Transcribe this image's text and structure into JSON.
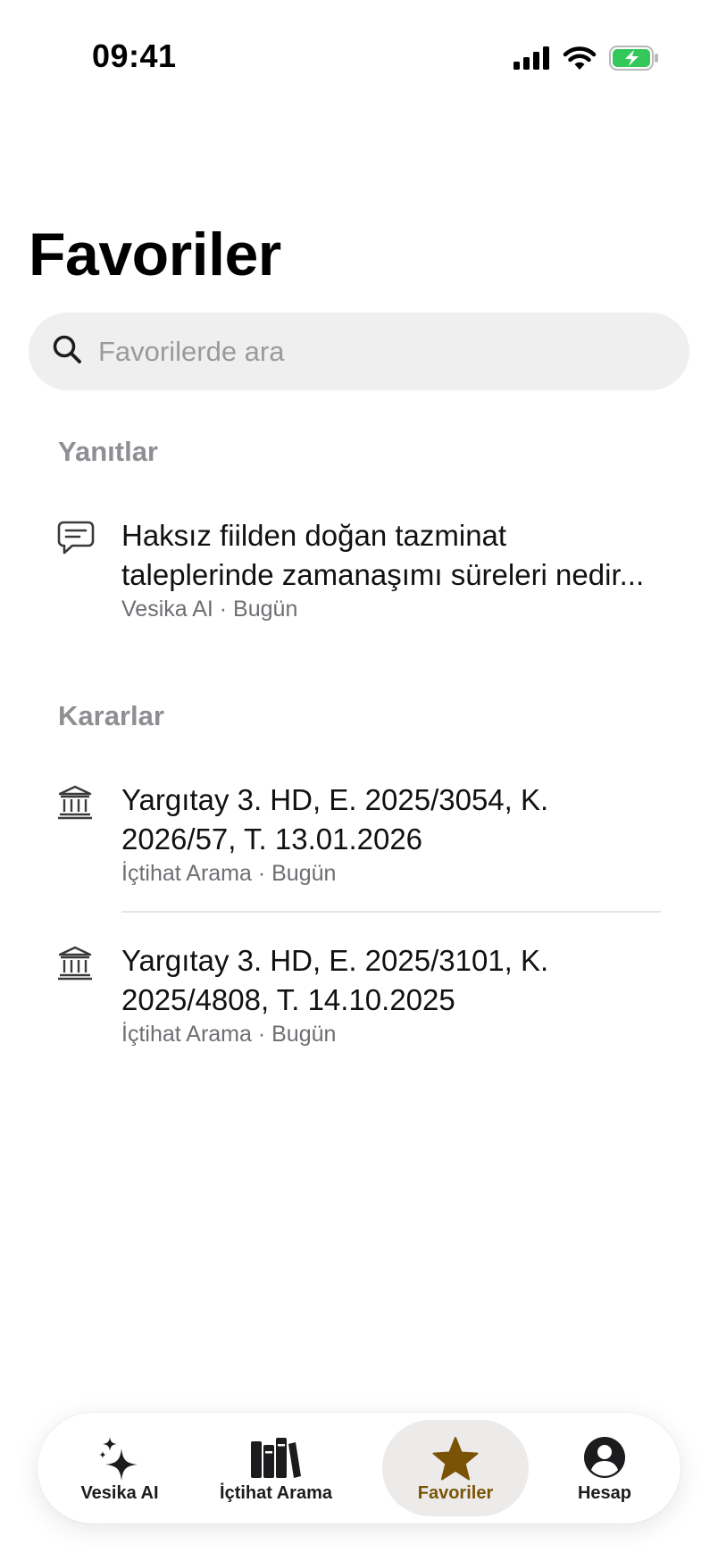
{
  "status_bar": {
    "time": "09:41",
    "signal_icon": "cellular-signal-icon",
    "wifi_icon": "wifi-icon",
    "battery_icon": "battery-charging-icon",
    "battery_color": "#34c759"
  },
  "header": {
    "title": "Favoriler"
  },
  "search": {
    "icon": "search-icon",
    "placeholder": "Favorilerde ara",
    "value": ""
  },
  "sections": {
    "answers": {
      "title": "Yanıtlar",
      "items": [
        {
          "icon": "chat-bubble-icon",
          "title_line1": "Haksız fiilden doğan tazminat",
          "title_line2": "taleplerinde zamanaşımı süreleri nedir...",
          "meta": "Vesika AI · Bugün"
        }
      ]
    },
    "decisions": {
      "title": "Kararlar",
      "items": [
        {
          "icon": "courthouse-icon",
          "title_line1": "Yargıtay 3. HD, E. 2025/3054, K.",
          "title_line2": "2026/57, T. 13.01.2026",
          "meta": "İçtihat Arama · Bugün"
        },
        {
          "icon": "courthouse-icon",
          "title_line1": "Yargıtay 3. HD, E. 2025/3101, K.",
          "title_line2": "2025/4808, T. 14.10.2025",
          "meta": "İçtihat Arama · Bugün"
        }
      ]
    }
  },
  "tab_bar": {
    "tabs": [
      {
        "label": "Vesika AI",
        "icon": "sparkles-icon",
        "active": false
      },
      {
        "label": "İçtihat Arama",
        "icon": "books-icon",
        "active": false
      },
      {
        "label": "Favoriler",
        "icon": "star-icon",
        "active": true
      },
      {
        "label": "Hesap",
        "icon": "person-circle-icon",
        "active": false
      }
    ],
    "active_color": "#7a5306"
  }
}
